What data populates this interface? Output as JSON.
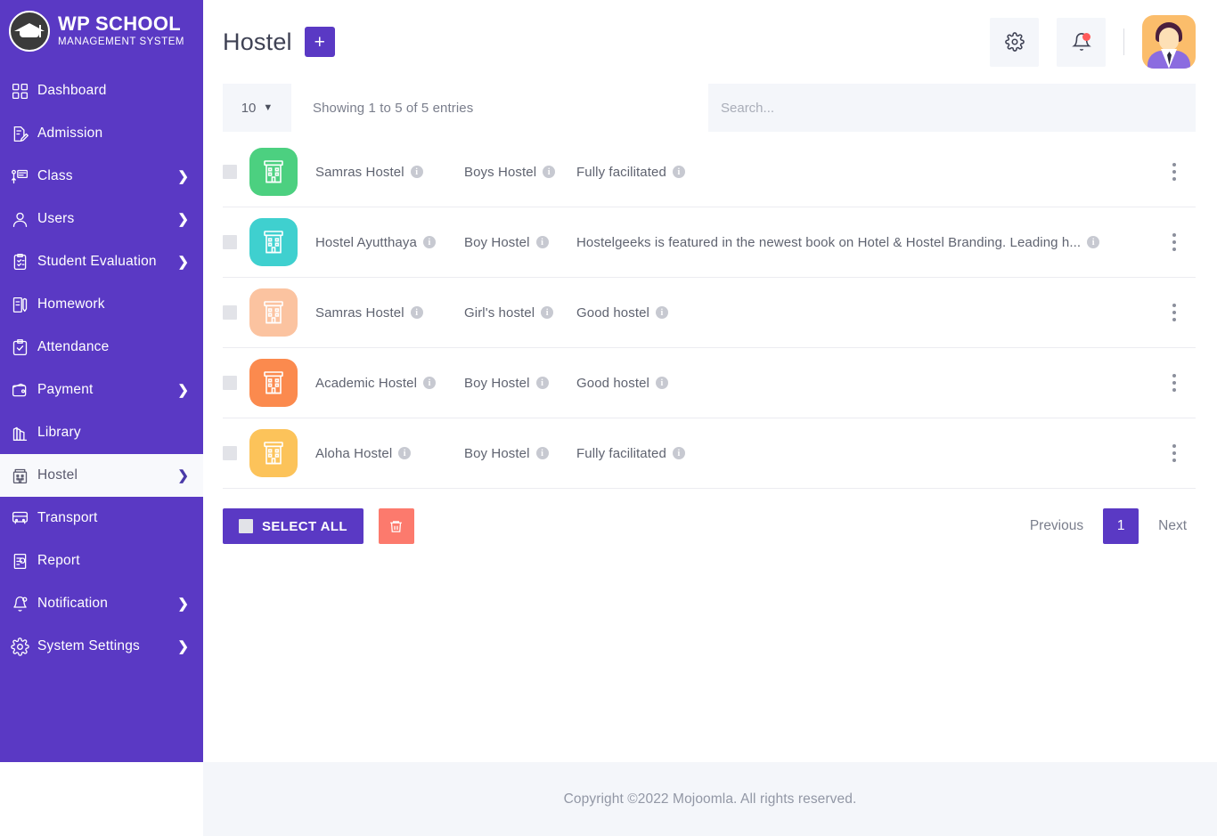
{
  "brand": {
    "title": "WP SCHOOL",
    "subtitle": "MANAGEMENT SYSTEM",
    "logo_icon": "graduation-cap-logo"
  },
  "colors": {
    "sidebar": "#5a39c4",
    "accent": "#5a39c4",
    "danger": "#fc7a6d",
    "muted_bg": "#f4f6fa",
    "active_item_bg": "#f8f9fc"
  },
  "sidebar": {
    "items": [
      {
        "label": "Dashboard",
        "icon": "grid-icon",
        "chevron": "",
        "active": false
      },
      {
        "label": "Admission",
        "icon": "document-pen-icon",
        "chevron": "",
        "active": false
      },
      {
        "label": "Class",
        "icon": "classroom-icon",
        "chevron": "❯",
        "active": false
      },
      {
        "label": "Users",
        "icon": "user-icon",
        "chevron": "❯",
        "active": false
      },
      {
        "label": "Student Evaluation",
        "icon": "clipboard-check-icon",
        "chevron": "❯",
        "active": false
      },
      {
        "label": "Homework",
        "icon": "book-pencil-icon",
        "chevron": "",
        "active": false
      },
      {
        "label": "Attendance",
        "icon": "clipboard-tick-icon",
        "chevron": "",
        "active": false
      },
      {
        "label": "Payment",
        "icon": "wallet-icon",
        "chevron": "❯",
        "active": false
      },
      {
        "label": "Library",
        "icon": "books-icon",
        "chevron": "",
        "active": false
      },
      {
        "label": "Hostel",
        "icon": "hostel-icon",
        "chevron": "❯",
        "active": true
      },
      {
        "label": "Transport",
        "icon": "bus-icon",
        "chevron": "",
        "active": false
      },
      {
        "label": "Report",
        "icon": "report-icon",
        "chevron": "",
        "active": false
      },
      {
        "label": "Notification",
        "icon": "bell-icon",
        "chevron": "❯",
        "active": false
      },
      {
        "label": "System Settings",
        "icon": "gear-icon",
        "chevron": "❯",
        "active": false
      }
    ]
  },
  "header": {
    "title": "Hostel",
    "add_label": "+",
    "settings_icon": "gear-icon",
    "notification_icon": "bell-icon",
    "has_notification_dot": true,
    "avatar_icon": "user-avatar"
  },
  "toolbar": {
    "page_length": "10",
    "page_length_chevron": "⌄",
    "showing_text": "Showing 1 to 5 of 5 entries",
    "search_placeholder": "Search...",
    "search_value": ""
  },
  "table": {
    "rows": [
      {
        "icon": "hostel-icon",
        "color": "#4cd080",
        "name": "Samras Hostel",
        "type": "Boys Hostel",
        "description": "Fully facilitated",
        "menu_icon": "kebab-menu-icon"
      },
      {
        "icon": "hostel-icon",
        "color": "#3fd0cf",
        "name": "Hostel Ayutthaya",
        "type": "Boy Hostel",
        "description": "Hostelgeeks is featured in the newest book on Hotel & Hostel Branding. Leading h...",
        "menu_icon": "kebab-menu-icon"
      },
      {
        "icon": "hostel-icon",
        "color": "#fbc3a0",
        "name": "Samras Hostel",
        "type": "Girl's hostel",
        "description": "Good hostel",
        "menu_icon": "kebab-menu-icon"
      },
      {
        "icon": "hostel-icon",
        "color": "#fb8a4e",
        "name": "Academic Hostel",
        "type": "Boy Hostel",
        "description": "Good hostel",
        "menu_icon": "kebab-menu-icon"
      },
      {
        "icon": "hostel-icon",
        "color": "#fcc35a",
        "name": "Aloha Hostel",
        "type": "Boy Hostel",
        "description": "Fully facilitated",
        "menu_icon": "kebab-menu-icon"
      }
    ],
    "info_glyph": "i"
  },
  "actions": {
    "select_all_label": "SELECT ALL",
    "delete_icon": "trash-icon"
  },
  "pagination": {
    "previous_label": "Previous",
    "current_page": "1",
    "next_label": "Next"
  },
  "footer": {
    "copyright": "Copyright ©2022 Mojoomla. All rights reserved."
  }
}
